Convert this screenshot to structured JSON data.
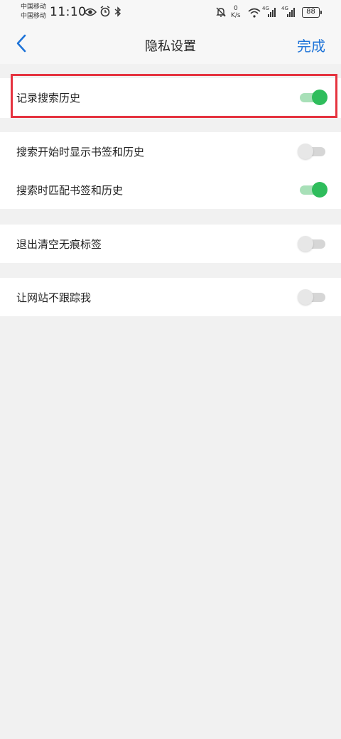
{
  "status_bar": {
    "carrier_1": "中国移动",
    "carrier_2": "中国移动",
    "time": "11:10",
    "net_speed_value": "0",
    "net_speed_unit": "K/s",
    "signal_1_label": "4G",
    "signal_2_label": "4G",
    "battery": "88",
    "icons": [
      "eye-icon",
      "alarm-icon",
      "bluetooth-icon",
      "mute-bell-icon",
      "wifi-icon",
      "signal-icon",
      "signal-icon",
      "battery-icon"
    ]
  },
  "header": {
    "title": "隐私设置",
    "done_label": "完成",
    "back_icon": "chevron-left-icon"
  },
  "settings": {
    "group1": [
      {
        "label": "记录搜索历史",
        "enabled": true
      }
    ],
    "group2": [
      {
        "label": "搜索开始时显示书签和历史",
        "enabled": false
      },
      {
        "label": "搜索时匹配书签和历史",
        "enabled": true
      }
    ],
    "group3": [
      {
        "label": "退出清空无痕标签",
        "enabled": false
      }
    ],
    "group4": [
      {
        "label": "让网站不跟踪我",
        "enabled": false
      }
    ]
  },
  "colors": {
    "accent_blue": "#1f74d8",
    "toggle_on": "#2fbd5c",
    "toggle_on_track": "#a8e0b8",
    "toggle_off_track": "#d6d6d6",
    "highlight_red": "#e5333f"
  }
}
